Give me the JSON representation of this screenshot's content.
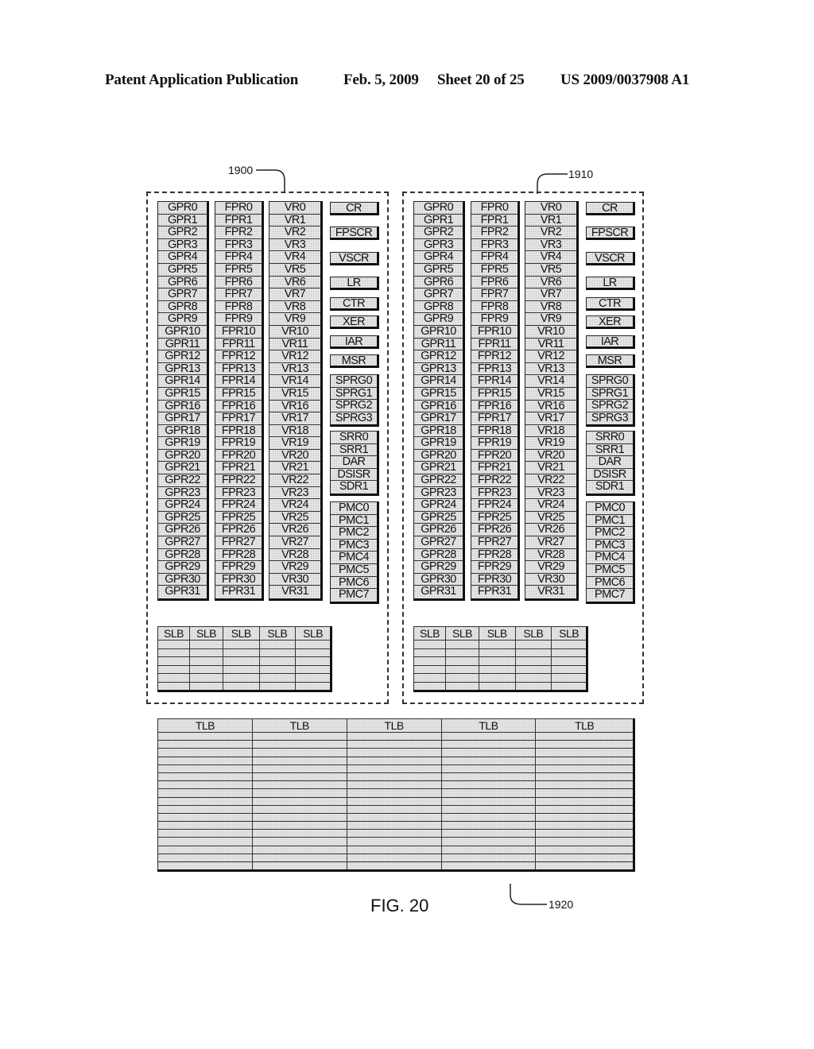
{
  "header": {
    "publication": "Patent Application Publication",
    "date": "Feb. 5, 2009",
    "sheet": "Sheet 20 of 25",
    "number": "US 2009/0037908 A1"
  },
  "figure": {
    "caption": "FIG. 20",
    "refs": {
      "left_block": "1900",
      "right_block": "1910",
      "tlb": "1920"
    }
  },
  "register_block": {
    "gpr": [
      "GPR0",
      "GPR1",
      "GPR2",
      "GPR3",
      "GPR4",
      "GPR5",
      "GPR6",
      "GPR7",
      "GPR8",
      "GPR9",
      "GPR10",
      "GPR11",
      "GPR12",
      "GPR13",
      "GPR14",
      "GPR15",
      "GPR16",
      "GPR17",
      "GPR18",
      "GPR19",
      "GPR20",
      "GPR21",
      "GPR22",
      "GPR23",
      "GPR24",
      "GPR25",
      "GPR26",
      "GPR27",
      "GPR28",
      "GPR29",
      "GPR30",
      "GPR31"
    ],
    "fpr": [
      "FPR0",
      "FPR1",
      "FPR2",
      "FPR3",
      "FPR4",
      "FPR5",
      "FPR6",
      "FPR7",
      "FPR8",
      "FPR9",
      "FPR10",
      "FPR11",
      "FPR12",
      "FPR13",
      "FPR14",
      "FPR15",
      "FPR16",
      "FPR17",
      "FPR18",
      "FPR19",
      "FPR20",
      "FPR21",
      "FPR22",
      "FPR23",
      "FPR24",
      "FPR25",
      "FPR26",
      "FPR27",
      "FPR28",
      "FPR29",
      "FPR30",
      "FPR31"
    ],
    "vr": [
      "VR0",
      "VR1",
      "VR2",
      "VR3",
      "VR4",
      "VR5",
      "VR6",
      "VR7",
      "VR8",
      "VR9",
      "VR10",
      "VR11",
      "VR12",
      "VR13",
      "VR14",
      "VR15",
      "VR16",
      "VR17",
      "VR18",
      "VR19",
      "VR20",
      "VR21",
      "VR22",
      "VR23",
      "VR24",
      "VR25",
      "VR26",
      "VR27",
      "VR28",
      "VR29",
      "VR30",
      "VR31"
    ],
    "special_single": [
      "CR",
      "FPSCR",
      "VSCR",
      "LR",
      "CTR",
      "XER",
      "IAR",
      "MSR"
    ],
    "sprg": [
      "SPRG0",
      "SPRG1",
      "SPRG2",
      "SPRG3"
    ],
    "srr": [
      "SRR0",
      "SRR1",
      "DAR",
      "DSISR",
      "SDR1"
    ],
    "pmc": [
      "PMC0",
      "PMC1",
      "PMC2",
      "PMC3",
      "PMC4",
      "PMC5",
      "PMC6",
      "PMC7"
    ],
    "slb": {
      "headers": [
        "SLB",
        "SLB",
        "SLB",
        "SLB",
        "SLB"
      ],
      "empty_rows": 6
    }
  },
  "tlb": {
    "headers": [
      "TLB",
      "TLB",
      "TLB",
      "TLB",
      "TLB"
    ],
    "empty_rows": 17
  }
}
